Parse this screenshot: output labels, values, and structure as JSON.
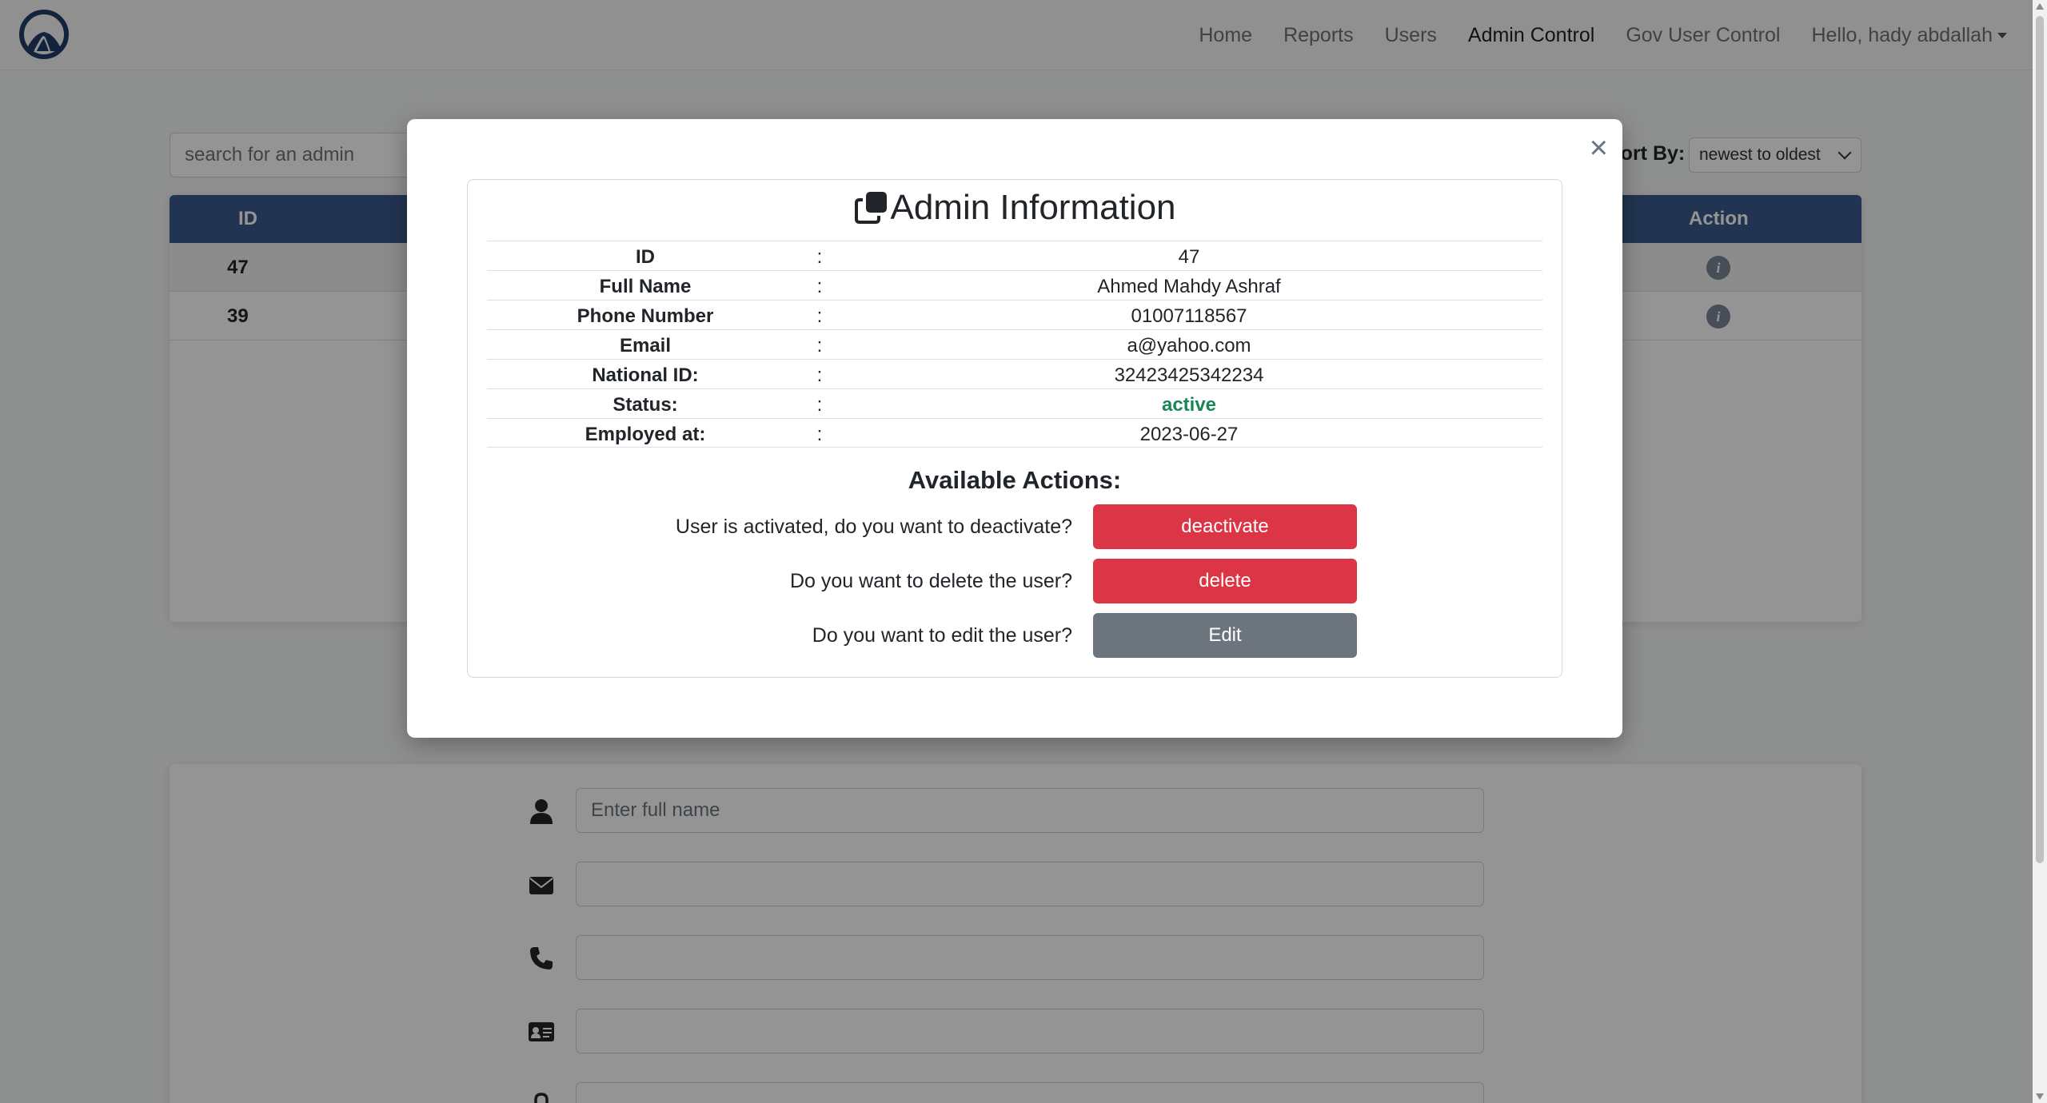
{
  "nav": {
    "links": [
      "Home",
      "Reports",
      "Users",
      "Admin Control",
      "Gov User Control"
    ],
    "user_menu": "Hello, hady abdallah"
  },
  "page": {
    "search_placeholder": "search for an admin",
    "sort_label": "Sort By:",
    "sort_value": "newest to oldest",
    "table": {
      "headers": {
        "id": "ID",
        "action": "Action"
      },
      "rows": [
        {
          "id": "47"
        },
        {
          "id": "39"
        }
      ]
    },
    "form": {
      "full_name_placeholder": "Enter full name"
    }
  },
  "modal": {
    "title": "Admin Information",
    "fields": [
      {
        "label": "ID",
        "value": "47"
      },
      {
        "label": "Full Name",
        "value": "Ahmed Mahdy Ashraf"
      },
      {
        "label": "Phone Number",
        "value": "01007118567"
      },
      {
        "label": "Email",
        "value": "a@yahoo.com"
      },
      {
        "label": "National ID:",
        "value": "32423425342234"
      },
      {
        "label": "Status:",
        "value": "active"
      },
      {
        "label": "Employed at:",
        "value": "2023-06-27"
      }
    ],
    "separator": ":",
    "actions_title": "Available Actions:",
    "actions": [
      {
        "prompt": "User is activated, do you want to deactivate?",
        "button": "deactivate"
      },
      {
        "prompt": "Do you want to delete the user?",
        "button": "delete"
      },
      {
        "prompt": "Do you want to edit the user?",
        "button": "Edit"
      }
    ]
  },
  "colors": {
    "navy_header": "#3a5a8c",
    "danger": "#dc3545",
    "secondary": "#6c757d",
    "success": "#198754"
  }
}
